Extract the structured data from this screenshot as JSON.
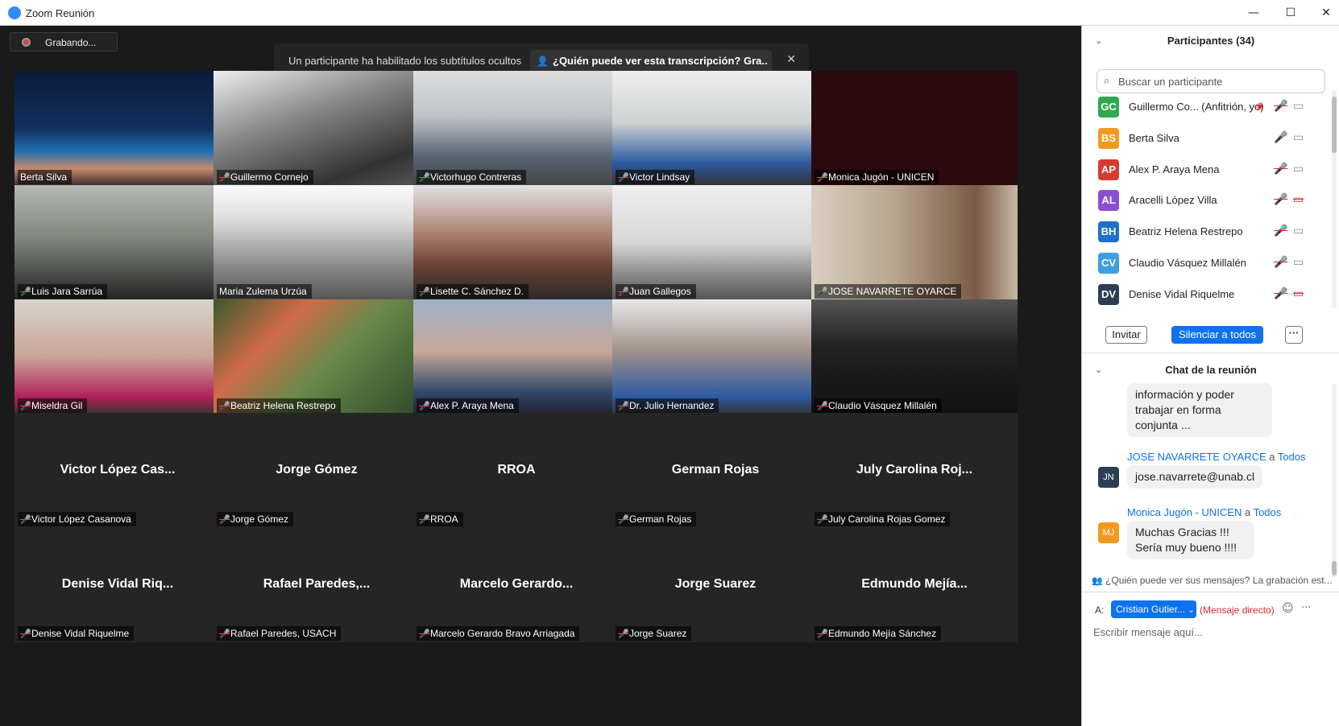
{
  "window": {
    "title": "Zoom Reunión",
    "minimize": "—",
    "maximize": "☐",
    "close": "✕"
  },
  "recording": {
    "label": "Grabando..."
  },
  "captions": {
    "notice": "Un participante ha habilitado los subtítulos ocultos",
    "link": "¿Quién puede ver esta transcripción? Gra...",
    "close": "✕"
  },
  "grid": [
    {
      "name": "Berta Silva",
      "muted": false,
      "video": true,
      "active": true,
      "bg": "linear-gradient(180deg,#0b1a3a 0%,#12305e 50%,#1f6fb0 70%,#c58a6a 85%,#3a2a30 100%)"
    },
    {
      "name": "Guillermo Cornejo",
      "muted": true,
      "video": true,
      "bg": "linear-gradient(160deg,#eee 0%,#888 40%,#333 80%,#555 100%)"
    },
    {
      "name": "Victorhugo Contreras",
      "muted": true,
      "video": true,
      "bg": "linear-gradient(180deg,#ddd 0%,#bfc3c7 40%,#566372 75%,#444 100%)"
    },
    {
      "name": "Victor Lindsay",
      "muted": true,
      "video": true,
      "bg": "linear-gradient(180deg,#eee 0%,#cfd2d2 45%,#2c5aa0 80%,#333 100%)"
    },
    {
      "name": "Monica Jugón - UNICEN",
      "muted": true,
      "video": true,
      "bg": "#2a0a0f"
    },
    {
      "name": "Luis Jara Sarrúa",
      "muted": true,
      "video": true,
      "bg": "linear-gradient(180deg,#b5b9b3 0%,#7c8079 50%,#222 100%)"
    },
    {
      "name": "Maria Zulema Urzúa",
      "muted": false,
      "video": true,
      "bg": "linear-gradient(180deg,#fafafa 0%,#ddd 30%,#8a8a8a 70%,#555 100%)"
    },
    {
      "name": "Lisette C. Sánchez D.",
      "muted": true,
      "video": true,
      "bg": "linear-gradient(180deg,#e2e2e2 0%,#a77a6a 45%,#6a4035 70%,#2a2a2a 100%)"
    },
    {
      "name": "Juan Gallegos",
      "muted": true,
      "video": true,
      "bg": "linear-gradient(180deg,#f0f0f0 0%,#d6d6d6 50%,#777 85%,#555 100%)"
    },
    {
      "name": "JOSE NAVARRETE OYARCE",
      "muted": true,
      "video": true,
      "bg": "linear-gradient(90deg,#d9cfc0 0%,#b9a68e 40%,#7a5a45 80%,#c9b8a8 100%)"
    },
    {
      "name": "Miseldra Gil",
      "muted": true,
      "video": true,
      "bg": "linear-gradient(180deg,#d8d3cc 0%,#c9a497 50%,#b0205a 85%,#333 100%)"
    },
    {
      "name": "Beatriz Helena Restrepo",
      "muted": true,
      "video": true,
      "bg": "linear-gradient(135deg,#3a5b2a 0%,#d06a4a 30%,#6a8a4a 55%,#2f4a2a 100%)"
    },
    {
      "name": "Alex P. Araya Mena",
      "muted": true,
      "video": true,
      "bg": "linear-gradient(180deg,#9fb1c8 0%,#c9a89a 45%,#324a6a 80%,#223 100%)"
    },
    {
      "name": "Dr. Julio Hernandez",
      "muted": true,
      "video": true,
      "bg": "linear-gradient(180deg,#e8e8e8 0%,#a0908a 45%,#2c5aa0 85%,#333 100%)"
    },
    {
      "name": "Claudio Vásquez Millalén",
      "muted": true,
      "video": true,
      "bg": "linear-gradient(180deg,#555 0%,#222 40%,#111 100%)"
    },
    {
      "name": "Victor López Casanova",
      "big": "Victor López Cas...",
      "muted": true,
      "video": false
    },
    {
      "name": "Jorge Gómez",
      "big": "Jorge Gómez",
      "muted": true,
      "video": false
    },
    {
      "name": "RROA",
      "big": "RROA",
      "muted": true,
      "video": false
    },
    {
      "name": "German Rojas",
      "big": "German Rojas",
      "muted": true,
      "video": false
    },
    {
      "name": "July Carolina Rojas Gomez",
      "big": "July Carolina Roj...",
      "muted": true,
      "video": false
    },
    {
      "name": "Denise Vidal Riquelme",
      "big": "Denise Vidal Riq...",
      "muted": true,
      "video": false
    },
    {
      "name": "Rafael Paredes, USACH",
      "big": "Rafael Paredes,...",
      "muted": true,
      "video": false
    },
    {
      "name": "Marcelo Gerardo Bravo Arriagada",
      "big": "Marcelo Gerardo...",
      "muted": true,
      "video": false
    },
    {
      "name": "Jorge Suarez",
      "big": "Jorge Suarez",
      "muted": true,
      "video": false
    },
    {
      "name": "Edmundo Mejía Sánchez",
      "big": "Edmundo Mejía...",
      "muted": true,
      "video": false
    }
  ],
  "participants": {
    "header": "Participantes (34)",
    "search_placeholder": "Buscar un participante",
    "list": [
      {
        "initials": "GC",
        "name": "Guillermo Co... (Anfitrión, yo)",
        "color": "#2fa84f",
        "mic": "muted",
        "video": "on",
        "recording": true
      },
      {
        "initials": "BS",
        "name": "Berta Silva",
        "color": "#f29a1f",
        "mic": "on",
        "video": "on"
      },
      {
        "initials": "AP",
        "name": "Alex P. Araya Mena",
        "color": "#d63b2f",
        "mic": "muted",
        "video": "on"
      },
      {
        "initials": "AL",
        "name": "Aracelli López Villa",
        "color": "#8a4fd1",
        "mic": "muted",
        "video": "off"
      },
      {
        "initials": "BH",
        "name": "Beatriz Helena Restrepo",
        "color": "#1f6fd1",
        "mic": "muted",
        "video": "on"
      },
      {
        "initials": "CV",
        "name": "Claudio Vásquez Millalén",
        "color": "#3aa0e0",
        "mic": "muted",
        "video": "on"
      },
      {
        "initials": "DV",
        "name": "Denise Vidal Riquelme",
        "color": "#2c3e55",
        "mic": "muted",
        "video": "off"
      }
    ],
    "invite": "Invitar",
    "mute_all": "Silenciar a todos",
    "more": "···"
  },
  "chat": {
    "header": "Chat de la reunión",
    "partial_message": "información y poder trabajar en forma conjunta ...",
    "messages": [
      {
        "initials": "JN",
        "from": "JOSE NAVARRETE OYARCE",
        "to_word": "a",
        "to": "Todos",
        "text": "jose.navarrete@unab.cl",
        "av_bg": "#2c3e55",
        "av_fg": "#fff"
      },
      {
        "initials": "MJ",
        "from": "Monica Jugón - UNICEN",
        "to_word": "a",
        "to": "Todos",
        "text": "Muchas Gracias !!! Sería muy bueno !!!!",
        "av_bg": "#f29a1f",
        "av_fg": "#fff"
      }
    ],
    "who_sees": "¿Quién puede ver sus mensajes? La grabación est...",
    "to_label": "A:",
    "recipient": "Cristian Gutier...",
    "direct": "(Mensaje directo)",
    "input_placeholder": "Escribir mensaje aquí..."
  }
}
